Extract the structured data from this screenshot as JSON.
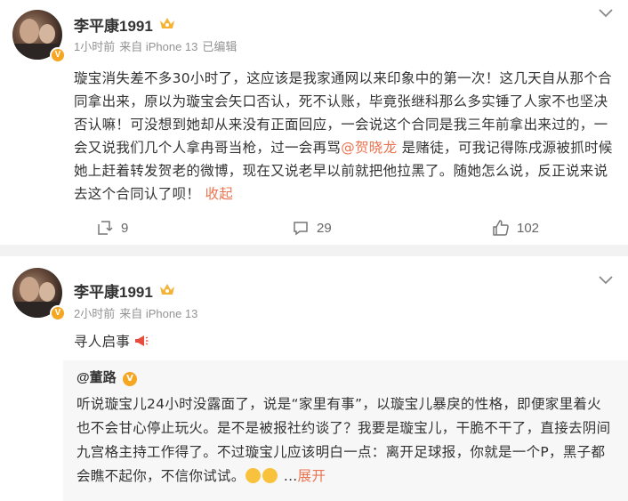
{
  "posts": [
    {
      "username": "李平康1991",
      "meta": {
        "time": "1小时前",
        "source": "来自 iPhone 13",
        "edited": "已编辑"
      },
      "content": {
        "part1": "璇宝消失差不多30小时了，这应该是我家通网以来印象中的第一次！这几天自从那个合同拿出来，原以为璇宝会矢口否认，死不认账，毕竟张继科那么多实锤了人家不也坚决否认嘛！可没想到她却从来没有正面回应，一会说这个合同是我三年前拿出来过的，一会又说我们几个人拿冉哥当枪，过一会再骂",
        "mention": "@贺晓龙",
        "part2": " 是赌徒，可我记得陈戌源被抓时候她上赶着转发贺老的微博，现在又说老早以前就把他拉黑了。随她怎么说，反正说来说去这个合同认了呗！",
        "collapse": "收起"
      },
      "actions": {
        "repost": "9",
        "comment": "29",
        "like": "102"
      }
    },
    {
      "username": "李平康1991",
      "meta": {
        "time": "2小时前",
        "source": "来自 iPhone 13"
      },
      "content": {
        "text": "寻人启事"
      },
      "retweet": {
        "author": "@董路",
        "text": "听说璇宝儿24小时没露面了，说是“家里有事”，以璇宝儿暴戾的性格，即便家里着火也不会甘心停止玩火。是不是被报社约谈了？我要是璇宝儿，干脆不干了，直接去阴间九宫格主持工作得了。不过璇宝儿应该明白一点：离开足球报，你就是一个P，黑子都会瞧不起你，不信你试试。",
        "ellipsis": "...",
        "expand": "展开"
      }
    }
  ],
  "icons": {
    "vip_badge": "V",
    "repost": "repost-icon",
    "comment": "comment-icon",
    "like": "like-icon"
  },
  "colors": {
    "accent": "#eb7350",
    "badge": "#f5a623",
    "meta": "#939393"
  }
}
